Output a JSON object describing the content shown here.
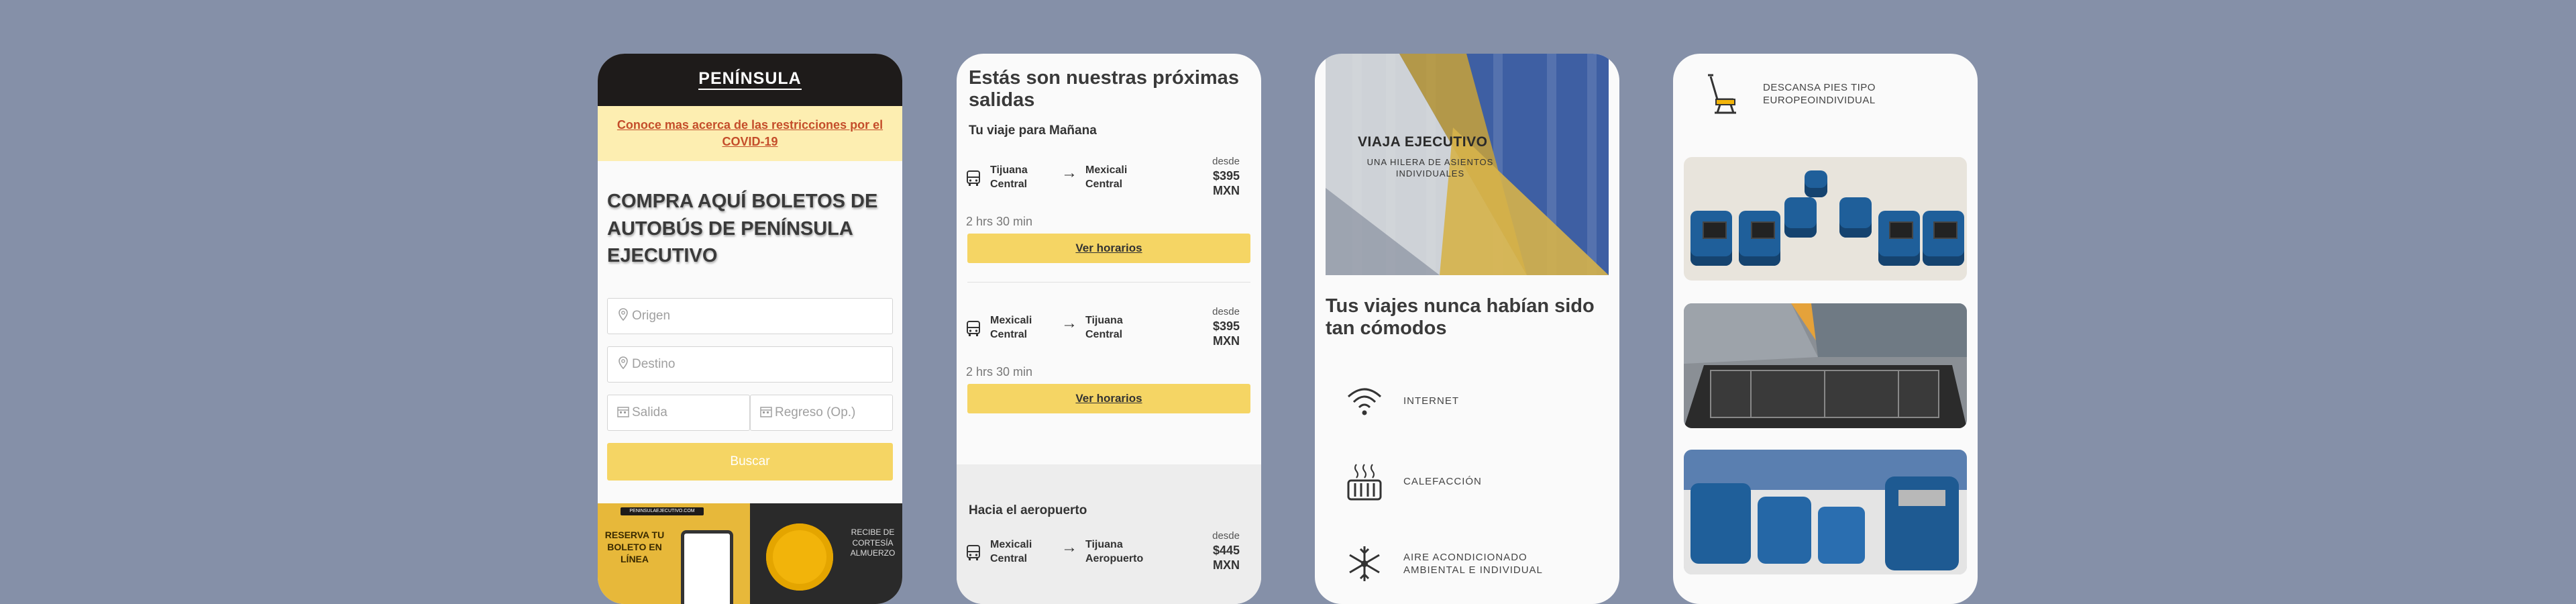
{
  "phone1": {
    "logo": "PENÍNSULA",
    "covid_link": "Conoce mas acerca de las restricciones por el COVID-19",
    "title": "COMPRA AQUÍ BOLETOS DE AUTOBÚS DE PENÍNSULA EJECUTIVO",
    "origin_placeholder": "Origen",
    "destination_placeholder": "Destino",
    "depart_placeholder": "Salida",
    "return_placeholder": "Regreso (Op.)",
    "search_button": "Buscar",
    "promo": {
      "tag": "PENINSULAEJECUTIVO.COM",
      "left_text": "RESERVA TU BOLETO EN LÍNEA",
      "right_text": "RECIBE DE CORTESÍA ALMUERZO"
    }
  },
  "phone2": {
    "heading": "Estás son nuestras próximas salidas",
    "section1": "Tu viaje para Mañana",
    "section2": "Hacia el aeropuerto",
    "trips": [
      {
        "from": "Tijuana Central",
        "to": "Mexicali Central",
        "desde": "desde",
        "price": "$395 MXN",
        "duration": "2 hrs 30 min",
        "button": "Ver horarios"
      },
      {
        "from": "Mexicali Central",
        "to": "Tijuana Central",
        "desde": "desde",
        "price": "$395 MXN",
        "duration": "2 hrs 30 min",
        "button": "Ver horarios"
      },
      {
        "from": "Mexicali Central",
        "to": "Tijuana Aeropuerto",
        "desde": "desde",
        "price": "$445 MXN"
      }
    ]
  },
  "phone3": {
    "image_title": "VIAJA EJECUTIVO",
    "image_subtitle": "UNA HILERA DE ASIENTOS INDIVIDUALES",
    "heading": "Tus viajes nunca habían sido tan cómodos",
    "amenities": [
      {
        "icon": "wifi-icon",
        "label": "INTERNET"
      },
      {
        "icon": "heater-icon",
        "label": "CALEFACCIÓN"
      },
      {
        "icon": "snowflake-icon",
        "label": "AIRE ACONDICIONADO AMBIENTAL E INDIVIDUAL"
      }
    ]
  },
  "phone4": {
    "feature": {
      "icon": "seat-icon",
      "label": "DESCANSA PIES TIPO EUROPEOINDIVIDUAL"
    }
  },
  "colors": {
    "background": "#8590a8",
    "accent_yellow": "#f5d564",
    "header_dark": "#1e1b1a",
    "covid_banner": "#fdeeb1",
    "covid_link": "#c44d2a"
  }
}
